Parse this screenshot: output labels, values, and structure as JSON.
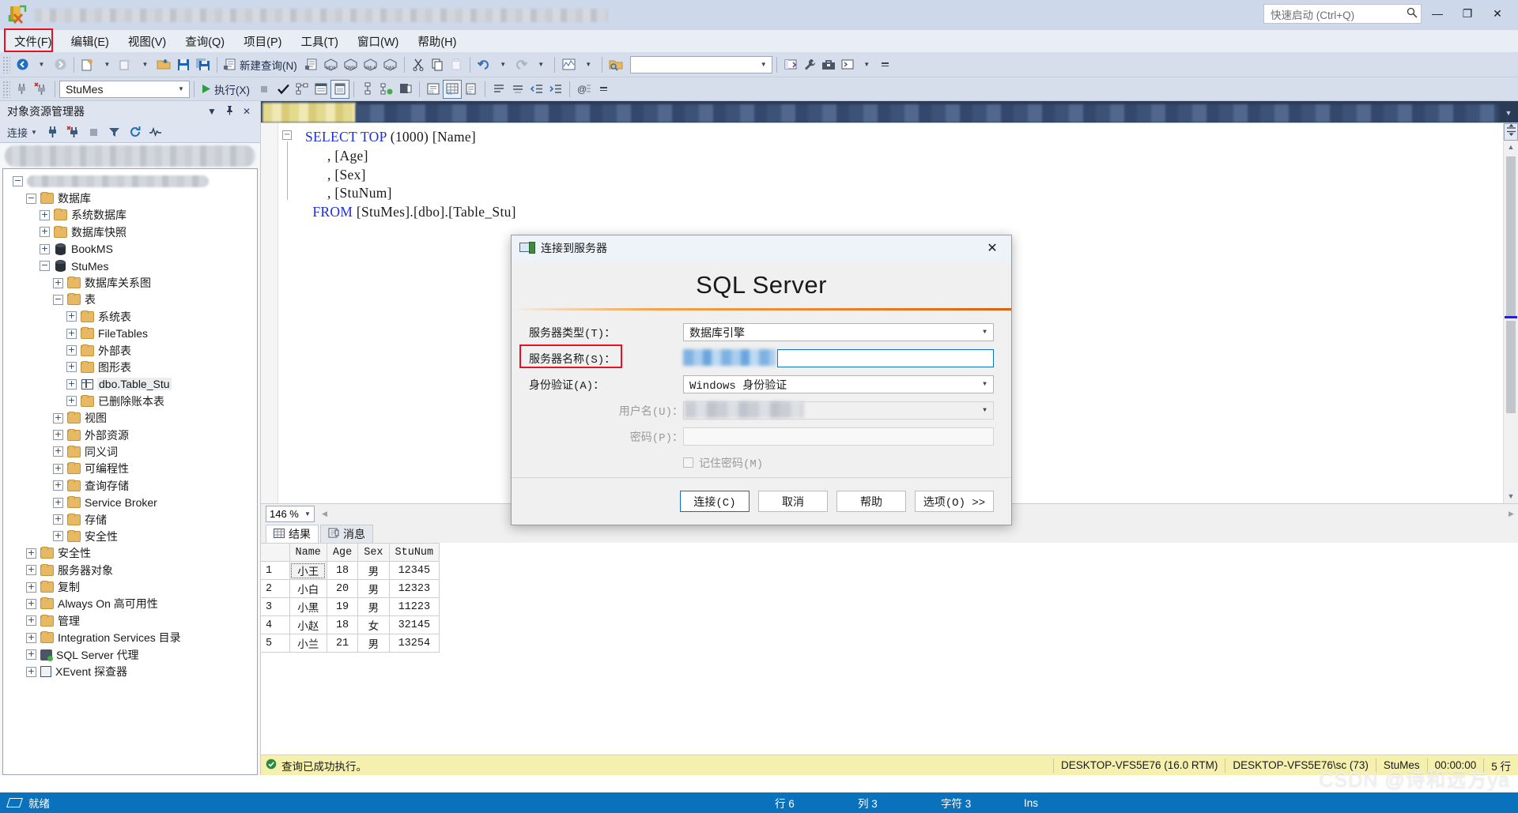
{
  "titlebar": {
    "quick_launch_placeholder": "快速启动 (Ctrl+Q)",
    "search_icon": "search-icon",
    "minimize": "—",
    "restore": "❐",
    "close": "✕"
  },
  "menubar": {
    "items": [
      {
        "label": "文件(F)",
        "highlighted": true
      },
      {
        "label": "编辑(E)",
        "highlighted": false
      },
      {
        "label": "视图(V)",
        "highlighted": false
      },
      {
        "label": "查询(Q)",
        "highlighted": false
      },
      {
        "label": "项目(P)",
        "highlighted": false
      },
      {
        "label": "工具(T)",
        "highlighted": false
      },
      {
        "label": "窗口(W)",
        "highlighted": false
      },
      {
        "label": "帮助(H)",
        "highlighted": false
      }
    ],
    "highlight_color": "#e81123"
  },
  "toolbar1": {
    "new_query_label": "新建查询(N)",
    "icons": [
      "nav-back-icon",
      "nav-forward-icon",
      "new-project-icon",
      "new-item-icon",
      "open-file-icon",
      "save-icon",
      "save-all-icon",
      "new-query-icon",
      "new-analysis-query-icon",
      "new-mdx-query-icon",
      "new-dmx-query-icon",
      "new-xmla-query-icon",
      "new-dax-query-icon",
      "cut-icon",
      "copy-icon",
      "paste-icon",
      "undo-icon",
      "redo-icon",
      "activity-monitor-icon",
      "find-folder-icon",
      "properties-window-icon",
      "wrench-icon",
      "toolbox-icon",
      "terminal-icon"
    ]
  },
  "toolbar2": {
    "database_combo_value": "StuMes",
    "execute_label": "执行(X)",
    "icons": [
      "connect-icon",
      "disconnect-icon",
      "execute-icon",
      "stop-icon",
      "parse-icon",
      "display-estimated-plan-icon",
      "query-options-icon",
      "include-actual-plan-icon",
      "include-client-statistics-icon",
      "include-live-query-stats-icon",
      "sqlcmd-mode-icon",
      "results-to-text-icon",
      "results-to-grid-icon",
      "results-to-file-icon"
    ]
  },
  "object_explorer": {
    "title": "对象资源管理器",
    "dropdown_icon": "chevron-down-icon",
    "pin_icon": "pin-icon",
    "close_icon": "close-icon",
    "connect_label": "连接",
    "toolbar_icons": [
      "connect-icon",
      "disconnect-icon",
      "stop-icon",
      "filter-icon",
      "refresh-icon",
      "activity-monitor-icon"
    ],
    "tree": [
      {
        "label": "",
        "indent": 0,
        "expander": "-",
        "icon": "server-icon",
        "blurred": true
      },
      {
        "label": "数据库",
        "indent": 1,
        "expander": "-",
        "icon": "folder"
      },
      {
        "label": "系统数据库",
        "indent": 2,
        "expander": "+",
        "icon": "folder"
      },
      {
        "label": "数据库快照",
        "indent": 2,
        "expander": "+",
        "icon": "folder"
      },
      {
        "label": "BookMS",
        "indent": 2,
        "expander": "+",
        "icon": "db"
      },
      {
        "label": "StuMes",
        "indent": 2,
        "expander": "-",
        "icon": "db"
      },
      {
        "label": "数据库关系图",
        "indent": 3,
        "expander": "+",
        "icon": "folder"
      },
      {
        "label": "表",
        "indent": 3,
        "expander": "-",
        "icon": "folder"
      },
      {
        "label": "系统表",
        "indent": 4,
        "expander": "+",
        "icon": "folder"
      },
      {
        "label": "FileTables",
        "indent": 4,
        "expander": "+",
        "icon": "folder"
      },
      {
        "label": "外部表",
        "indent": 4,
        "expander": "+",
        "icon": "folder"
      },
      {
        "label": "图形表",
        "indent": 4,
        "expander": "+",
        "icon": "folder"
      },
      {
        "label": "dbo.Table_Stu",
        "indent": 4,
        "expander": "+",
        "icon": "tbl",
        "selected": true
      },
      {
        "label": "已删除账本表",
        "indent": 4,
        "expander": "+",
        "icon": "folder"
      },
      {
        "label": "视图",
        "indent": 3,
        "expander": "+",
        "icon": "folder"
      },
      {
        "label": "外部资源",
        "indent": 3,
        "expander": "+",
        "icon": "folder"
      },
      {
        "label": "同义词",
        "indent": 3,
        "expander": "+",
        "icon": "folder"
      },
      {
        "label": "可编程性",
        "indent": 3,
        "expander": "+",
        "icon": "folder"
      },
      {
        "label": "查询存储",
        "indent": 3,
        "expander": "+",
        "icon": "folder"
      },
      {
        "label": "Service Broker",
        "indent": 3,
        "expander": "+",
        "icon": "folder"
      },
      {
        "label": "存储",
        "indent": 3,
        "expander": "+",
        "icon": "folder"
      },
      {
        "label": "安全性",
        "indent": 3,
        "expander": "+",
        "icon": "folder"
      },
      {
        "label": "安全性",
        "indent": 1,
        "expander": "+",
        "icon": "folder"
      },
      {
        "label": "服务器对象",
        "indent": 1,
        "expander": "+",
        "icon": "folder"
      },
      {
        "label": "复制",
        "indent": 1,
        "expander": "+",
        "icon": "folder"
      },
      {
        "label": "Always On 高可用性",
        "indent": 1,
        "expander": "+",
        "icon": "folder"
      },
      {
        "label": "管理",
        "indent": 1,
        "expander": "+",
        "icon": "folder"
      },
      {
        "label": "Integration Services 目录",
        "indent": 1,
        "expander": "+",
        "icon": "folder"
      },
      {
        "label": "SQL Server 代理",
        "indent": 1,
        "expander": "+",
        "icon": "agent"
      },
      {
        "label": "XEvent 探查器",
        "indent": 1,
        "expander": "+",
        "icon": "xevent"
      }
    ]
  },
  "editor": {
    "fold_glyph": "−",
    "lines": [
      {
        "parts": [
          {
            "t": "SELECT TOP ",
            "k": true
          },
          {
            "t": "(1000) [Name]",
            "k": false
          }
        ]
      },
      {
        "parts": [
          {
            "t": "      , [Age]",
            "k": false
          }
        ]
      },
      {
        "parts": [
          {
            "t": "      , [Sex]",
            "k": false
          }
        ]
      },
      {
        "parts": [
          {
            "t": "      , [StuNum]",
            "k": false
          }
        ]
      },
      {
        "parts": [
          {
            "t": "  FROM ",
            "k": true
          },
          {
            "t": "[StuMes].[dbo].[Table_Stu]",
            "k": false
          }
        ]
      }
    ]
  },
  "results": {
    "zoom_level": "146 %",
    "tabs": [
      {
        "label": "结果",
        "icon": "grid-icon",
        "active": true
      },
      {
        "label": "消息",
        "icon": "message-icon",
        "active": false
      }
    ],
    "columns": [
      "Name",
      "Age",
      "Sex",
      "StuNum"
    ],
    "rows": [
      {
        "n": "1",
        "Name": "小王",
        "Age": "18",
        "Sex": "男",
        "StuNum": "12345",
        "selected": true
      },
      {
        "n": "2",
        "Name": "小白",
        "Age": "20",
        "Sex": "男",
        "StuNum": "12323",
        "selected": false
      },
      {
        "n": "3",
        "Name": "小黑",
        "Age": "19",
        "Sex": "男",
        "StuNum": "11223",
        "selected": false
      },
      {
        "n": "4",
        "Name": "小赵",
        "Age": "18",
        "Sex": "女",
        "StuNum": "32145",
        "selected": false
      },
      {
        "n": "5",
        "Name": "小兰",
        "Age": "21",
        "Sex": "男",
        "StuNum": "13254",
        "selected": false
      }
    ]
  },
  "message_bar": {
    "status_icon": "success-icon",
    "text": "查询已成功执行。",
    "server": "DESKTOP-VFS5E76 (16.0 RTM)",
    "login": "DESKTOP-VFS5E76\\sc (73)",
    "database": "StuMes",
    "elapsed": "00:00:00",
    "rowcount": "5 行"
  },
  "statusbar": {
    "ready_icon": "ready-icon",
    "ready": "就绪",
    "line": "行 6",
    "column": "列 3",
    "char": "字符 3",
    "insert_mode": "Ins"
  },
  "watermark": "CSDN @诗和远方ya",
  "dialog": {
    "icon": "server-connect-icon",
    "title": "连接到服务器",
    "close_icon": "✕",
    "hero": "SQL Server",
    "fields": {
      "server_type_label": "服务器类型(T)：",
      "server_type_value": "数据库引擎",
      "server_name_label": "服务器名称(S)：",
      "server_name_value": "",
      "auth_label": "身份验证(A)：",
      "auth_value": "Windows 身份验证",
      "username_label": "用户名(U)：",
      "username_value": "",
      "password_label": "密码(P)：",
      "password_value": "",
      "remember_label": "记住密码(M)"
    },
    "highlight_color": "#e81123",
    "buttons": [
      {
        "label": "连接(C)",
        "primary": true
      },
      {
        "label": "取消",
        "primary": false
      },
      {
        "label": "帮助",
        "primary": false
      },
      {
        "label": "选项(O)  >>",
        "primary": false
      }
    ]
  }
}
